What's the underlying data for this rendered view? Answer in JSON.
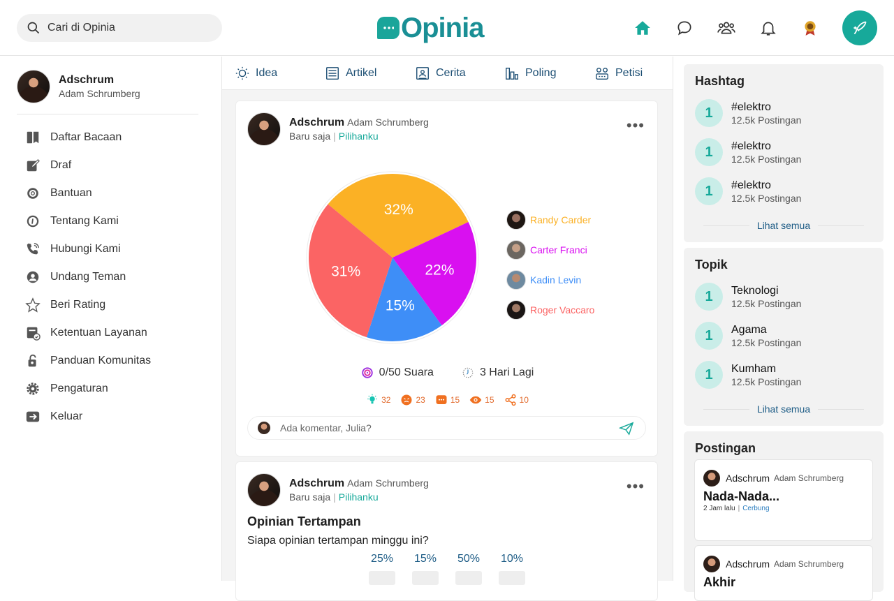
{
  "search": {
    "placeholder": "Cari di Opinia"
  },
  "brand": {
    "name": "Opinia",
    "color": "#17a99a"
  },
  "nav": {
    "icons": [
      "home-icon",
      "chat-icon",
      "groups-icon",
      "bell-icon",
      "award-icon"
    ],
    "create_icon": "quill-icon"
  },
  "profile": {
    "name": "Adschrum",
    "username": "Adam Schrumberg"
  },
  "menu": [
    {
      "label": "Daftar Bacaan",
      "icon": "bookmark-icon"
    },
    {
      "label": "Draf",
      "icon": "draft-icon"
    },
    {
      "label": "Bantuan",
      "icon": "lifebuoy-icon"
    },
    {
      "label": "Tentang Kami",
      "icon": "info-icon"
    },
    {
      "label": "Hubungi Kami",
      "icon": "phone-icon"
    },
    {
      "label": "Undang Teman",
      "icon": "invite-icon"
    },
    {
      "label": "Beri Rating",
      "icon": "star-icon"
    },
    {
      "label": "Ketentuan Layanan",
      "icon": "terms-icon"
    },
    {
      "label": "Panduan Komunitas",
      "icon": "guide-icon"
    },
    {
      "label": "Pengaturan",
      "icon": "gear-icon"
    },
    {
      "label": "Keluar",
      "icon": "logout-icon"
    }
  ],
  "tabs": [
    {
      "label": "Idea",
      "icon": "bulb-icon"
    },
    {
      "label": "Artikel",
      "icon": "article-icon"
    },
    {
      "label": "Cerita",
      "icon": "story-icon"
    },
    {
      "label": "Poling",
      "icon": "poll-icon"
    },
    {
      "label": "Petisi",
      "icon": "petition-icon"
    }
  ],
  "post1": {
    "name": "Adschrum",
    "username": "Adam Schrumberg",
    "time": "Baru saja",
    "category": "Pilihanku",
    "votes": "0/50 Suara",
    "time_left": "3 Hari Lagi",
    "reactions": {
      "ideas": "32",
      "angry": "23",
      "comments": "15",
      "views": "15",
      "shares": "10"
    },
    "comment_placeholder": "Ada komentar, Julia?"
  },
  "chart_data": {
    "type": "pie",
    "slices": [
      {
        "name": "Randy Carder",
        "value": 32,
        "label": "32%",
        "color": "#fbb125"
      },
      {
        "name": "Carter Franci",
        "value": 22,
        "label": "22%",
        "color": "#d910f0"
      },
      {
        "name": "Kadin Levin",
        "value": 15,
        "label": "15%",
        "color": "#3e8ef7"
      },
      {
        "name": "Roger Vaccaro",
        "value": 31,
        "label": "31%",
        "color": "#fb6464"
      }
    ],
    "legend": "right"
  },
  "post2": {
    "name": "Adschrum",
    "username": "Adam Schrumberg",
    "time": "Baru saja",
    "category": "Pilihanku",
    "title": "Opinian Tertampan",
    "question": "Siapa opinian tertampan minggu ini?",
    "options": [
      {
        "label": "25%"
      },
      {
        "label": "15%"
      },
      {
        "label": "50%"
      },
      {
        "label": "10%"
      }
    ]
  },
  "hashtag": {
    "title": "Hashtag",
    "items": [
      {
        "num": "1",
        "name": "#elektro",
        "count": "12.5k Postingan"
      },
      {
        "num": "1",
        "name": "#elektro",
        "count": "12.5k Postingan"
      },
      {
        "num": "1",
        "name": "#elektro",
        "count": "12.5k Postingan"
      }
    ],
    "see_all": "Lihat semua"
  },
  "topic": {
    "title": "Topik",
    "items": [
      {
        "num": "1",
        "name": "Teknologi",
        "count": "12.5k Postingan"
      },
      {
        "num": "1",
        "name": "Agama",
        "count": "12.5k Postingan"
      },
      {
        "num": "1",
        "name": "Kumham",
        "count": "12.5k Postingan"
      }
    ],
    "see_all": "Lihat semua"
  },
  "posts": {
    "title": "Postingan",
    "items": [
      {
        "name": "Adschrum",
        "username": "Adam Schrumberg",
        "title": "Nada-Nada...",
        "time": "2 Jam lalu",
        "category": "Cerbung"
      },
      {
        "name": "Adschrum",
        "username": "Adam Schrumberg",
        "title": "Akhir"
      }
    ]
  }
}
